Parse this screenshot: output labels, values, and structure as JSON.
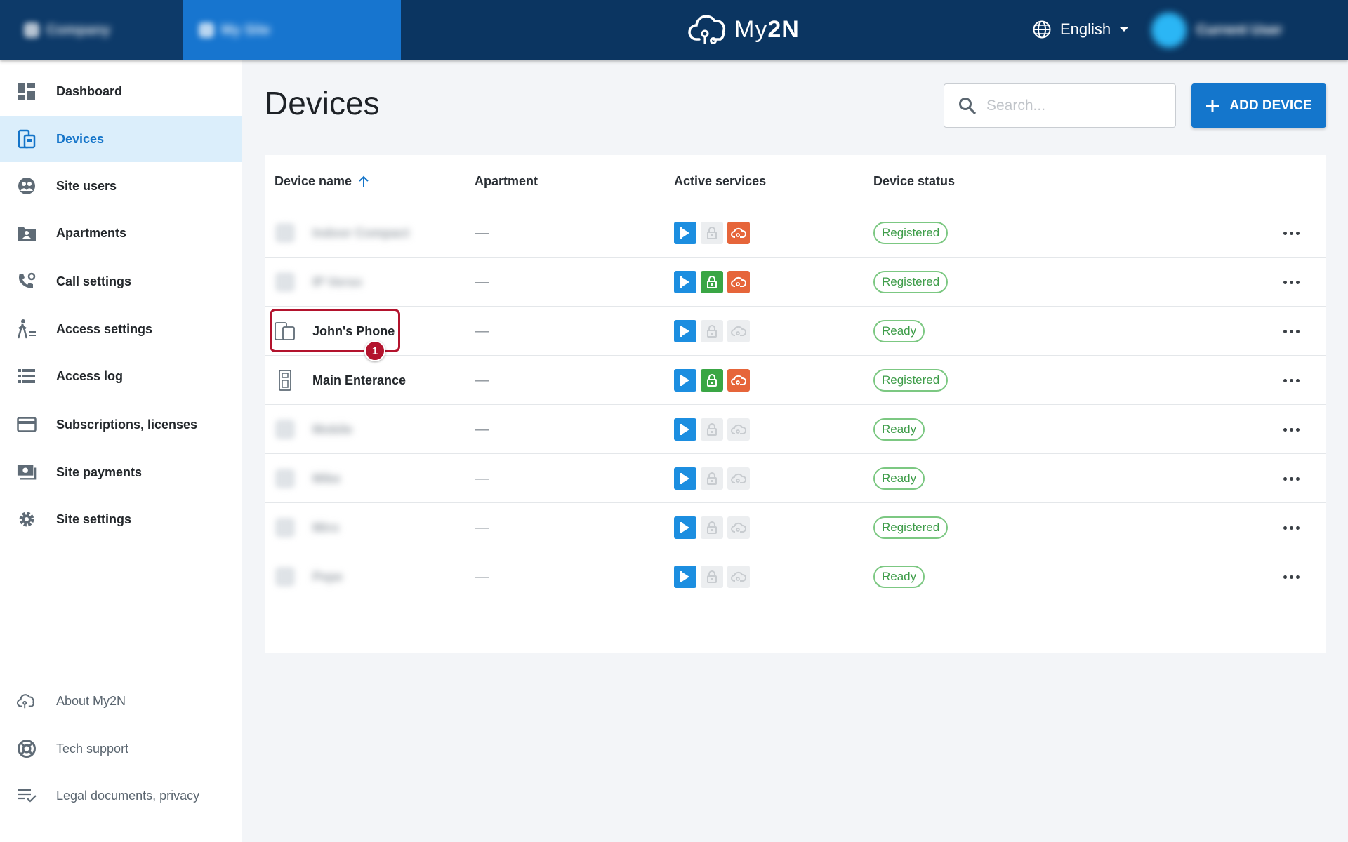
{
  "header": {
    "company_name": "Company",
    "site_name": "My Site",
    "logo_text_light": "My",
    "logo_text_bold": "2N",
    "language": "English",
    "user_name": "Current User"
  },
  "sidebar": {
    "items": [
      {
        "label": "Dashboard",
        "icon": "dashboard-icon"
      },
      {
        "label": "Devices",
        "icon": "devices-icon",
        "active": true
      },
      {
        "label": "Site users",
        "icon": "site-users-icon"
      },
      {
        "label": "Apartments",
        "icon": "apartments-icon"
      },
      {
        "label": "Call settings",
        "icon": "call-settings-icon"
      },
      {
        "label": "Access settings",
        "icon": "access-settings-icon"
      },
      {
        "label": "Access log",
        "icon": "access-log-icon"
      },
      {
        "label": "Subscriptions, licenses",
        "icon": "subscriptions-icon"
      },
      {
        "label": "Site payments",
        "icon": "payments-icon"
      },
      {
        "label": "Site settings",
        "icon": "gear-icon"
      }
    ],
    "footer": [
      {
        "label": "About My2N",
        "icon": "cloud-icon"
      },
      {
        "label": "Tech support",
        "icon": "lifebuoy-icon"
      },
      {
        "label": "Legal documents, privacy",
        "icon": "legal-list-icon"
      }
    ]
  },
  "main": {
    "title": "Devices",
    "search_placeholder": "Search...",
    "add_button": "ADD DEVICE"
  },
  "table": {
    "columns": [
      "Device name",
      "Apartment",
      "Active services",
      "Device status"
    ],
    "rows": [
      {
        "name": "Indoor Compact",
        "blurred": true,
        "apartment": "—",
        "services": {
          "play": true,
          "lock": false,
          "cloud": true
        },
        "status": "Registered"
      },
      {
        "name": "IP Verso",
        "blurred": true,
        "apartment": "—",
        "services": {
          "play": true,
          "lock": true,
          "cloud": true
        },
        "status": "Registered"
      },
      {
        "name": "John's Phone",
        "blurred": false,
        "apartment": "—",
        "services": {
          "play": true,
          "lock": false,
          "cloud": false
        },
        "status": "Ready"
      },
      {
        "name": "Main Enterance",
        "blurred": false,
        "apartment": "—",
        "services": {
          "play": true,
          "lock": true,
          "cloud": true
        },
        "status": "Registered"
      },
      {
        "name": "Mobile",
        "blurred": true,
        "apartment": "—",
        "services": {
          "play": true,
          "lock": false,
          "cloud": false
        },
        "status": "Ready"
      },
      {
        "name": "Mike",
        "blurred": true,
        "apartment": "—",
        "services": {
          "play": true,
          "lock": false,
          "cloud": false
        },
        "status": "Ready"
      },
      {
        "name": "Miro",
        "blurred": true,
        "apartment": "—",
        "services": {
          "play": true,
          "lock": false,
          "cloud": false
        },
        "status": "Registered"
      },
      {
        "name": "Pepe",
        "blurred": true,
        "apartment": "—",
        "services": {
          "play": true,
          "lock": false,
          "cloud": false
        },
        "status": "Ready"
      }
    ]
  },
  "annotation": {
    "marker_number": "1"
  },
  "colors": {
    "topbar": "#0b3561",
    "site_tab": "#1775cf",
    "accent": "#1476cc",
    "active_nav_bg": "#dbeefb",
    "status_green": "#3d9c48",
    "service_play": "#1c8ee0",
    "service_lock": "#3aa645",
    "service_cloud": "#e6653a",
    "annotation_red": "#b3132d"
  }
}
